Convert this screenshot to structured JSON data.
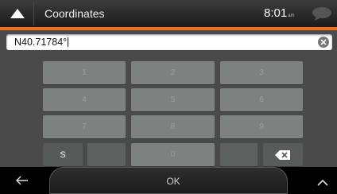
{
  "header": {
    "title": "Coordinates",
    "time": "8:01",
    "time_suffix": "am"
  },
  "input": {
    "value": "N40.71784°"
  },
  "keypad": {
    "keys": [
      "1",
      "2",
      "3",
      "4",
      "5",
      "6",
      "7",
      "8",
      "9",
      "S",
      "0"
    ]
  },
  "footer": {
    "ok_label": "OK"
  },
  "colors": {
    "accent": "#f06c1e",
    "keypad_bg": "#4a4a4a",
    "key": "#7d8281"
  },
  "icons": [
    "up-arrow-icon",
    "message-icon",
    "clear-icon",
    "backspace-icon",
    "back-arrow-icon",
    "chevron-up-icon"
  ]
}
